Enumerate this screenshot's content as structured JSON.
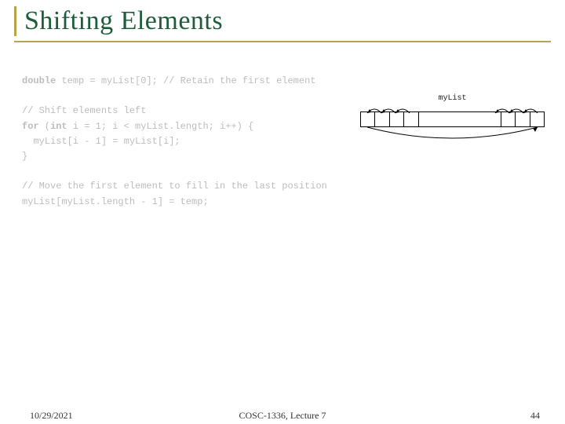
{
  "title": "Shifting Elements",
  "code": {
    "line1_kw": "double",
    "line1_rest": " temp = myList[0]; ",
    "line1_cmt": "// Retain the first element",
    "blank1": "",
    "line2_cmt": "// Shift elements left",
    "line3_kw1": "for",
    "line3_mid": " (",
    "line3_kw2": "int",
    "line3_rest": " i = 1; i < myList.length; i++) {",
    "line4": "  myList[i - 1] = myList[i];",
    "line5": "}",
    "blank2": "",
    "line6_cmt": "// Move the first element to fill in the last position",
    "line7": "myList[myList.length - 1] = temp;"
  },
  "diagram": {
    "label": "myList"
  },
  "footer": {
    "date": "10/29/2021",
    "course": "COSC-1336, Lecture 7",
    "page": "44"
  }
}
